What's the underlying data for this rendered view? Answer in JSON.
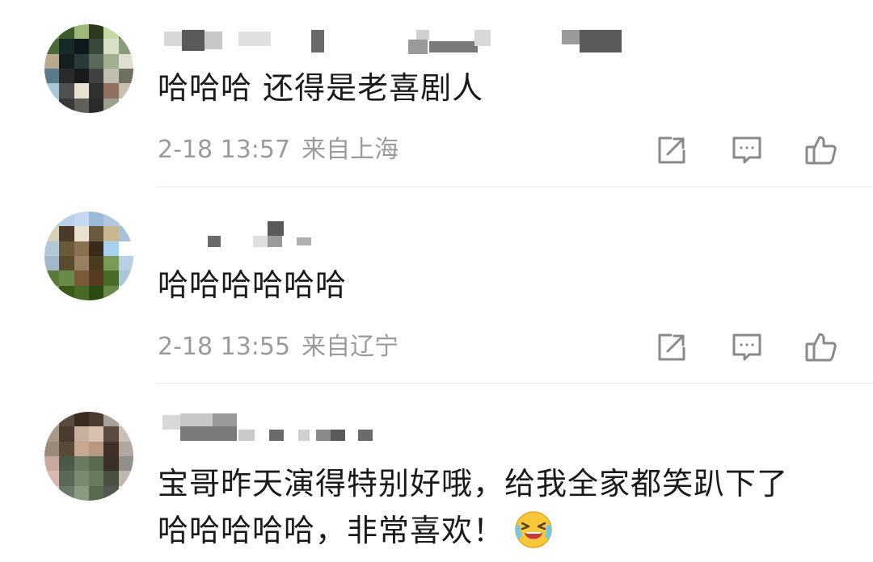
{
  "comments": [
    {
      "text": "哈哈哈 还得是老喜剧人",
      "date": "2-18 13:57",
      "location": "来自上海"
    },
    {
      "text": "哈哈哈哈哈哈",
      "date": "2-18 13:55",
      "location": "来自辽宁"
    },
    {
      "text_line1": "宝哥昨天演得特别好哦，给我全家都笑趴下了",
      "text_line2": "哈哈哈哈哈，非常喜欢！"
    }
  ],
  "icons": {
    "share": "share-icon",
    "reply": "comment-icon",
    "like": "thumbs-up-icon",
    "emoji": "laugh-cry-emoji"
  },
  "colors": {
    "text": "#1a1a1a",
    "meta": "#9b9b9b",
    "icon": "#8a8a8a",
    "divider": "#e6e6e6"
  }
}
